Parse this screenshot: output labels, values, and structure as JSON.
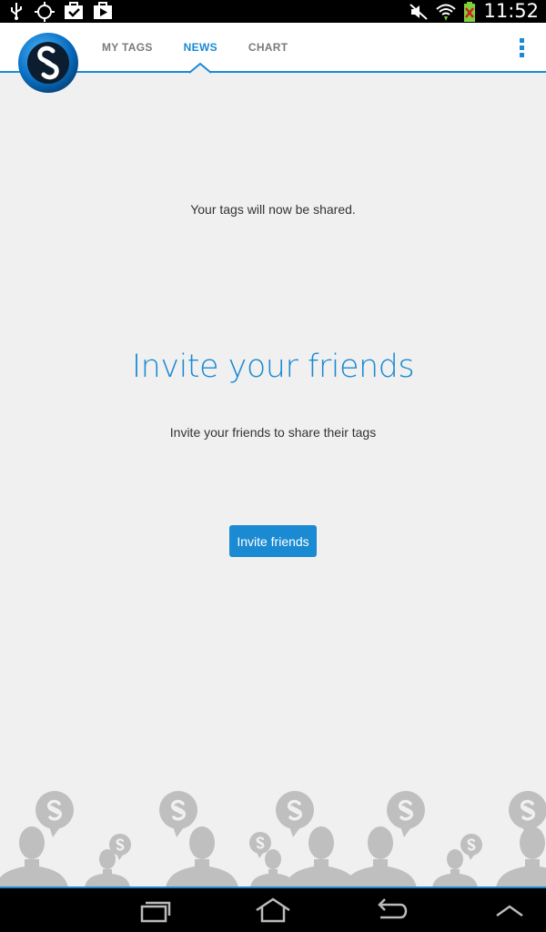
{
  "status_bar": {
    "time": "11:52",
    "icons": [
      "usb-icon",
      "gps-icon",
      "task-check-icon",
      "play-store-icon",
      "mute-icon",
      "wifi-icon",
      "battery-icon"
    ]
  },
  "tabs": [
    {
      "label": "MY TAGS",
      "active": false
    },
    {
      "label": "NEWS",
      "active": true
    },
    {
      "label": "CHART",
      "active": false
    }
  ],
  "content": {
    "shared_message": "Your tags will now be shared.",
    "headline": "Invite your friends",
    "subtext": "Invite your friends to share their tags",
    "invite_button": "Invite friends"
  },
  "nav_bar": [
    "recent-apps-icon",
    "home-icon",
    "back-icon",
    "menu-up-icon"
  ],
  "colors": {
    "accent": "#1a8ad2",
    "background": "#f0f0f0"
  }
}
